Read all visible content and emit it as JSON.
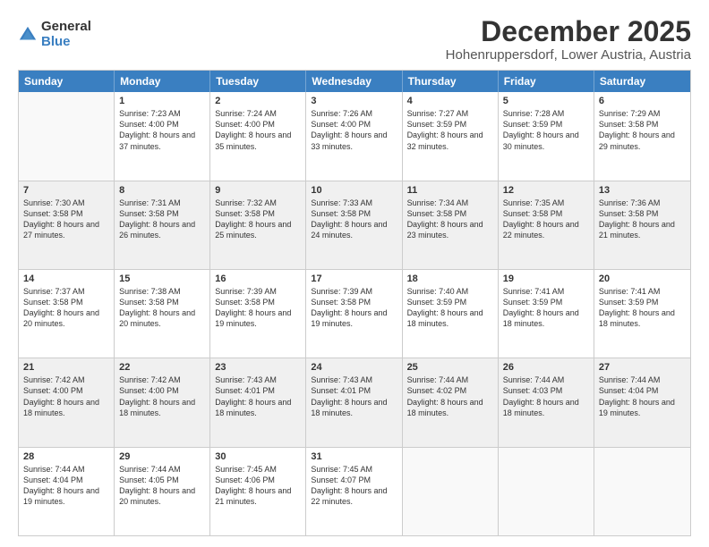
{
  "logo": {
    "general": "General",
    "blue": "Blue"
  },
  "title": "December 2025",
  "subtitle": "Hohenruppersdorf, Lower Austria, Austria",
  "header_days": [
    "Sunday",
    "Monday",
    "Tuesday",
    "Wednesday",
    "Thursday",
    "Friday",
    "Saturday"
  ],
  "weeks": [
    [
      {
        "day": "",
        "sunrise": "",
        "sunset": "",
        "daylight": "",
        "shaded": false,
        "empty": true
      },
      {
        "day": "1",
        "sunrise": "Sunrise: 7:23 AM",
        "sunset": "Sunset: 4:00 PM",
        "daylight": "Daylight: 8 hours and 37 minutes.",
        "shaded": false,
        "empty": false
      },
      {
        "day": "2",
        "sunrise": "Sunrise: 7:24 AM",
        "sunset": "Sunset: 4:00 PM",
        "daylight": "Daylight: 8 hours and 35 minutes.",
        "shaded": false,
        "empty": false
      },
      {
        "day": "3",
        "sunrise": "Sunrise: 7:26 AM",
        "sunset": "Sunset: 4:00 PM",
        "daylight": "Daylight: 8 hours and 33 minutes.",
        "shaded": false,
        "empty": false
      },
      {
        "day": "4",
        "sunrise": "Sunrise: 7:27 AM",
        "sunset": "Sunset: 3:59 PM",
        "daylight": "Daylight: 8 hours and 32 minutes.",
        "shaded": false,
        "empty": false
      },
      {
        "day": "5",
        "sunrise": "Sunrise: 7:28 AM",
        "sunset": "Sunset: 3:59 PM",
        "daylight": "Daylight: 8 hours and 30 minutes.",
        "shaded": false,
        "empty": false
      },
      {
        "day": "6",
        "sunrise": "Sunrise: 7:29 AM",
        "sunset": "Sunset: 3:58 PM",
        "daylight": "Daylight: 8 hours and 29 minutes.",
        "shaded": false,
        "empty": false
      }
    ],
    [
      {
        "day": "7",
        "sunrise": "Sunrise: 7:30 AM",
        "sunset": "Sunset: 3:58 PM",
        "daylight": "Daylight: 8 hours and 27 minutes.",
        "shaded": true,
        "empty": false
      },
      {
        "day": "8",
        "sunrise": "Sunrise: 7:31 AM",
        "sunset": "Sunset: 3:58 PM",
        "daylight": "Daylight: 8 hours and 26 minutes.",
        "shaded": true,
        "empty": false
      },
      {
        "day": "9",
        "sunrise": "Sunrise: 7:32 AM",
        "sunset": "Sunset: 3:58 PM",
        "daylight": "Daylight: 8 hours and 25 minutes.",
        "shaded": true,
        "empty": false
      },
      {
        "day": "10",
        "sunrise": "Sunrise: 7:33 AM",
        "sunset": "Sunset: 3:58 PM",
        "daylight": "Daylight: 8 hours and 24 minutes.",
        "shaded": true,
        "empty": false
      },
      {
        "day": "11",
        "sunrise": "Sunrise: 7:34 AM",
        "sunset": "Sunset: 3:58 PM",
        "daylight": "Daylight: 8 hours and 23 minutes.",
        "shaded": true,
        "empty": false
      },
      {
        "day": "12",
        "sunrise": "Sunrise: 7:35 AM",
        "sunset": "Sunset: 3:58 PM",
        "daylight": "Daylight: 8 hours and 22 minutes.",
        "shaded": true,
        "empty": false
      },
      {
        "day": "13",
        "sunrise": "Sunrise: 7:36 AM",
        "sunset": "Sunset: 3:58 PM",
        "daylight": "Daylight: 8 hours and 21 minutes.",
        "shaded": true,
        "empty": false
      }
    ],
    [
      {
        "day": "14",
        "sunrise": "Sunrise: 7:37 AM",
        "sunset": "Sunset: 3:58 PM",
        "daylight": "Daylight: 8 hours and 20 minutes.",
        "shaded": false,
        "empty": false
      },
      {
        "day": "15",
        "sunrise": "Sunrise: 7:38 AM",
        "sunset": "Sunset: 3:58 PM",
        "daylight": "Daylight: 8 hours and 20 minutes.",
        "shaded": false,
        "empty": false
      },
      {
        "day": "16",
        "sunrise": "Sunrise: 7:39 AM",
        "sunset": "Sunset: 3:58 PM",
        "daylight": "Daylight: 8 hours and 19 minutes.",
        "shaded": false,
        "empty": false
      },
      {
        "day": "17",
        "sunrise": "Sunrise: 7:39 AM",
        "sunset": "Sunset: 3:58 PM",
        "daylight": "Daylight: 8 hours and 19 minutes.",
        "shaded": false,
        "empty": false
      },
      {
        "day": "18",
        "sunrise": "Sunrise: 7:40 AM",
        "sunset": "Sunset: 3:59 PM",
        "daylight": "Daylight: 8 hours and 18 minutes.",
        "shaded": false,
        "empty": false
      },
      {
        "day": "19",
        "sunrise": "Sunrise: 7:41 AM",
        "sunset": "Sunset: 3:59 PM",
        "daylight": "Daylight: 8 hours and 18 minutes.",
        "shaded": false,
        "empty": false
      },
      {
        "day": "20",
        "sunrise": "Sunrise: 7:41 AM",
        "sunset": "Sunset: 3:59 PM",
        "daylight": "Daylight: 8 hours and 18 minutes.",
        "shaded": false,
        "empty": false
      }
    ],
    [
      {
        "day": "21",
        "sunrise": "Sunrise: 7:42 AM",
        "sunset": "Sunset: 4:00 PM",
        "daylight": "Daylight: 8 hours and 18 minutes.",
        "shaded": true,
        "empty": false
      },
      {
        "day": "22",
        "sunrise": "Sunrise: 7:42 AM",
        "sunset": "Sunset: 4:00 PM",
        "daylight": "Daylight: 8 hours and 18 minutes.",
        "shaded": true,
        "empty": false
      },
      {
        "day": "23",
        "sunrise": "Sunrise: 7:43 AM",
        "sunset": "Sunset: 4:01 PM",
        "daylight": "Daylight: 8 hours and 18 minutes.",
        "shaded": true,
        "empty": false
      },
      {
        "day": "24",
        "sunrise": "Sunrise: 7:43 AM",
        "sunset": "Sunset: 4:01 PM",
        "daylight": "Daylight: 8 hours and 18 minutes.",
        "shaded": true,
        "empty": false
      },
      {
        "day": "25",
        "sunrise": "Sunrise: 7:44 AM",
        "sunset": "Sunset: 4:02 PM",
        "daylight": "Daylight: 8 hours and 18 minutes.",
        "shaded": true,
        "empty": false
      },
      {
        "day": "26",
        "sunrise": "Sunrise: 7:44 AM",
        "sunset": "Sunset: 4:03 PM",
        "daylight": "Daylight: 8 hours and 18 minutes.",
        "shaded": true,
        "empty": false
      },
      {
        "day": "27",
        "sunrise": "Sunrise: 7:44 AM",
        "sunset": "Sunset: 4:04 PM",
        "daylight": "Daylight: 8 hours and 19 minutes.",
        "shaded": true,
        "empty": false
      }
    ],
    [
      {
        "day": "28",
        "sunrise": "Sunrise: 7:44 AM",
        "sunset": "Sunset: 4:04 PM",
        "daylight": "Daylight: 8 hours and 19 minutes.",
        "shaded": false,
        "empty": false
      },
      {
        "day": "29",
        "sunrise": "Sunrise: 7:44 AM",
        "sunset": "Sunset: 4:05 PM",
        "daylight": "Daylight: 8 hours and 20 minutes.",
        "shaded": false,
        "empty": false
      },
      {
        "day": "30",
        "sunrise": "Sunrise: 7:45 AM",
        "sunset": "Sunset: 4:06 PM",
        "daylight": "Daylight: 8 hours and 21 minutes.",
        "shaded": false,
        "empty": false
      },
      {
        "day": "31",
        "sunrise": "Sunrise: 7:45 AM",
        "sunset": "Sunset: 4:07 PM",
        "daylight": "Daylight: 8 hours and 22 minutes.",
        "shaded": false,
        "empty": false
      },
      {
        "day": "",
        "sunrise": "",
        "sunset": "",
        "daylight": "",
        "shaded": false,
        "empty": true
      },
      {
        "day": "",
        "sunrise": "",
        "sunset": "",
        "daylight": "",
        "shaded": false,
        "empty": true
      },
      {
        "day": "",
        "sunrise": "",
        "sunset": "",
        "daylight": "",
        "shaded": false,
        "empty": true
      }
    ]
  ]
}
